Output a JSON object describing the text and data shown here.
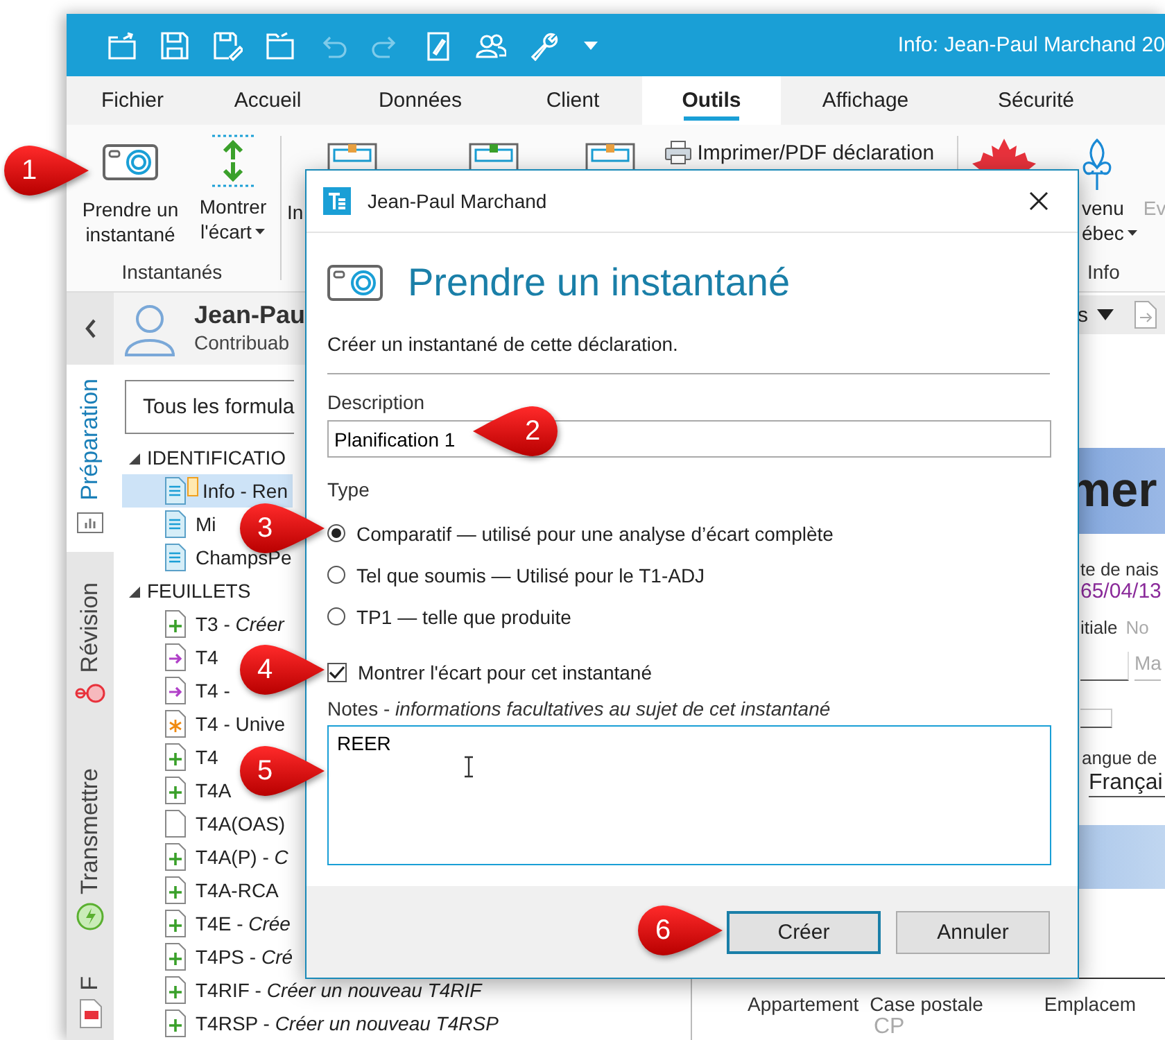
{
  "window": {
    "title": "Info: Jean-Paul Marchand 20"
  },
  "ribbon_tabs": [
    {
      "label": "Fichier",
      "selected": false
    },
    {
      "label": "Accueil",
      "selected": false
    },
    {
      "label": "Données",
      "selected": false
    },
    {
      "label": "Client",
      "selected": false
    },
    {
      "label": "Outils",
      "selected": true
    },
    {
      "label": "Affichage",
      "selected": false
    },
    {
      "label": "Sécurité",
      "selected": false
    }
  ],
  "ribbon": {
    "snapshot_group": {
      "label": "Instantanés",
      "buttons": [
        {
          "kind": "camera",
          "lines": [
            "Prendre un",
            "instantané"
          ],
          "dropdown": false
        },
        {
          "kind": "gap",
          "lines": [
            "Montrer",
            "l'écart"
          ],
          "dropdown": true
        }
      ]
    },
    "cut_label": "In",
    "print_button": "Imprimer/PDF déclaration",
    "info_group": {
      "label": "Info",
      "buttons": [
        {
          "lines": [
            "venu",
            "ébec"
          ],
          "dropdown": true,
          "disabled": false
        },
        {
          "lines": [
            "Ev"
          ],
          "dropdown": false,
          "disabled": true
        }
      ]
    }
  },
  "sidebar": {
    "rail_tabs": [
      {
        "label": "Préparation",
        "selected": true,
        "kind": "chart"
      },
      {
        "label": "Révision",
        "selected": false,
        "kind": "review"
      },
      {
        "label": "Transmettre",
        "selected": false,
        "kind": "send"
      },
      {
        "label": "F",
        "selected": false,
        "kind": "pdf"
      }
    ],
    "person": {
      "name": "Jean-Pau",
      "role": "Contribuab"
    },
    "filter": "Tous les formula",
    "tree": [
      {
        "label": "IDENTIFICATIO",
        "expanded": true,
        "children": [
          {
            "label": "Info - Ren",
            "kind": "form",
            "selected": true,
            "flagged": true
          },
          {
            "label": "Mi",
            "kind": "form",
            "selected": false,
            "flagged": false
          },
          {
            "label": "ChampsPe",
            "kind": "form",
            "selected": false,
            "flagged": false
          }
        ]
      },
      {
        "label": "FEUILLETS",
        "expanded": true,
        "children": [
          {
            "label": "T3 - *Créer*",
            "kind": "add",
            "selected": false,
            "flagged": false
          },
          {
            "label": "T4",
            "kind": "arrow",
            "selected": false,
            "flagged": false
          },
          {
            "label": "T4 -",
            "kind": "arrow",
            "selected": false,
            "flagged": false
          },
          {
            "label": "T4 - Unive",
            "kind": "star",
            "selected": false,
            "flagged": false
          },
          {
            "label": "T4",
            "kind": "add",
            "selected": false,
            "flagged": false
          },
          {
            "label": "T4A",
            "kind": "add",
            "selected": false,
            "flagged": false
          },
          {
            "label": "T4A(OAS)",
            "kind": "blank",
            "selected": false,
            "flagged": false
          },
          {
            "label": "T4A(P) - *C*",
            "kind": "add",
            "selected": false,
            "flagged": false
          },
          {
            "label": "T4A-RCA",
            "kind": "add",
            "selected": false,
            "flagged": false
          },
          {
            "label": "T4E - *Crée*",
            "kind": "add",
            "selected": false,
            "flagged": false
          },
          {
            "label": "T4PS - *Cré*",
            "kind": "add",
            "selected": false,
            "flagged": false
          },
          {
            "label": "T4RIF - *Créer un nouveau T4RIF*",
            "kind": "add",
            "selected": false,
            "flagged": false
          },
          {
            "label": "T4RSP - *Créer un nouveau T4RSP*",
            "kind": "add",
            "selected": false,
            "flagged": false
          }
        ]
      }
    ]
  },
  "document": {
    "toolbar_label": "s",
    "heading": "mer",
    "birth_label": "te de nais",
    "birth_value": "65/04/13",
    "initial_label": "itiale",
    "name_label": "No",
    "name_value": "Ma",
    "language_label": "angue de",
    "language_value": "Françai",
    "address_columns": [
      "Appartement",
      "Case postale",
      "Emplacem"
    ],
    "po_box_value": "CP"
  },
  "dialog": {
    "title": "Jean-Paul Marchand",
    "heading": "Prendre un instantané",
    "intro": "Créer un instantané de cette déclaration.",
    "description": {
      "label": "Description",
      "value": "Planification 1"
    },
    "type": {
      "label": "Type",
      "options": [
        {
          "label": "Comparatif — utilisé pour une analyse d’écart complète",
          "selected": true
        },
        {
          "label": "Tel que soumis — Utilisé pour le T1-ADJ",
          "selected": false
        },
        {
          "label": "TP1 — telle que produite",
          "selected": false
        }
      ]
    },
    "show_gap": {
      "label": "Montrer l'écart pour cet instantané",
      "checked": true
    },
    "notes": {
      "label": "Notes - *informations facultatives au sujet de cet instantané*",
      "value": "REER"
    },
    "buttons": [
      {
        "label": "Créer",
        "default": true
      },
      {
        "label": "Annuler",
        "default": false
      }
    ]
  },
  "callouts": [
    {
      "label": "1"
    },
    {
      "label": "2"
    },
    {
      "label": "3"
    },
    {
      "label": "4"
    },
    {
      "label": "5"
    },
    {
      "label": "6"
    }
  ]
}
